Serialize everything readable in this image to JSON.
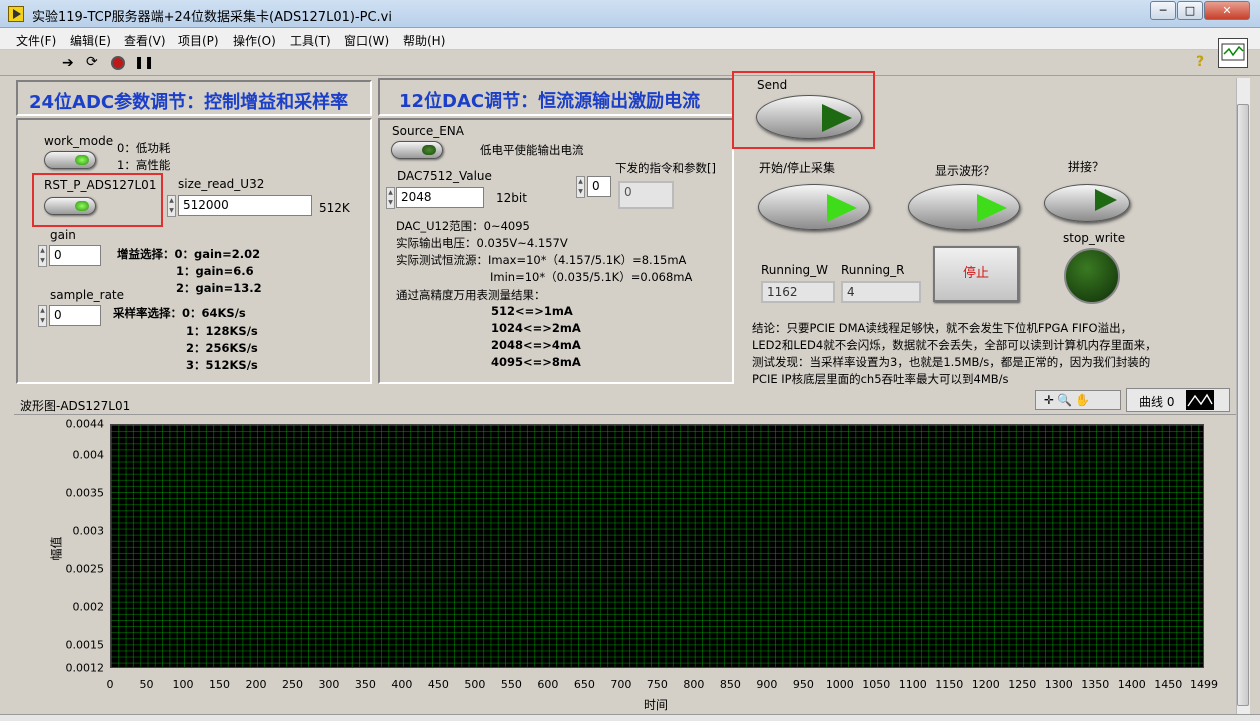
{
  "window": {
    "title": "实验119-TCP服务器端+24位数据采集卡(ADS127L01)-PC.vi",
    "min": "─",
    "max": "□",
    "close": "✕"
  },
  "menu": [
    "文件(F)",
    "编辑(E)",
    "查看(V)",
    "项目(P)",
    "操作(O)",
    "工具(T)",
    "窗口(W)",
    "帮助(H)"
  ],
  "adc": {
    "title": "24位ADC参数调节：控制增益和采样率",
    "work_mode_label": "work_mode",
    "mode0": "0：低功耗",
    "mode1": "1：高性能",
    "rst_label": "RST_P_ADS127L01",
    "size_label": "size_read_U32",
    "size_value": "512000",
    "size_unit": "512K",
    "gain_label": "gain",
    "gain_value": "0",
    "gain_sel": "增益选择：0：gain=2.02",
    "gain1": "1：gain=6.6",
    "gain2": "2：gain=13.2",
    "rate_label": "sample_rate",
    "rate_value": "0",
    "rate_sel": "采样率选择：0：64KS/s",
    "rate1": "1：128KS/s",
    "rate2": "2：256KS/s",
    "rate3": "3：512KS/s"
  },
  "dac": {
    "title": "12位DAC调节：恒流源输出激励电流",
    "source_label": "Source_ENA",
    "source_desc": "低电平使能输出电流",
    "dac_label": "DAC7512_Value",
    "dac_value": "2048",
    "dac_bits": "12bit",
    "cmd_label": "下发的指令和参数[]",
    "cmd_index": "0",
    "cmd_value": "0",
    "range": "DAC_U12范围：0~4095",
    "voltage": "实际输出电压：0.035V~4.157V",
    "current1": "实际测试恒流源：Imax=10*（4.157/5.1K）=8.15mA",
    "current2": "Imin=10*（0.035/5.1K）=0.068mA",
    "meas": "通过高精度万用表测量结果：",
    "m1": "512<=>1mA",
    "m2": "1024<=>2mA",
    "m3": "2048<=>4mA",
    "m4": "4095<=>8mA"
  },
  "ctrl": {
    "send_label": "Send",
    "start_label": "开始/停止采集",
    "show_label": "显示波形？",
    "splice_label": "拼接？",
    "stop_write_label": "stop_write",
    "rw_label": "Running_W",
    "rw_value": "1162",
    "rr_label": "Running_R",
    "rr_value": "4",
    "stop_btn": "停止",
    "note1": "结论：只要PCIE DMA读线程足够快，就不会发生下位机FPGA FIFO溢出，",
    "note2": "LED2和LED4就不会闪烁，数据就不会丢失，全部可以读到计算机内存里面来，",
    "note3": "测试发现：当采样率设置为3，也就是1.5MB/s，都是正常的，因为我们封装的",
    "note4": "PCIE IP核底层里面的ch5吞吐率最大可以到4MB/s"
  },
  "graph": {
    "title": "波形图-ADS127L01",
    "legend": "曲线 0",
    "ylabel": "幅值",
    "xlabel": "时间",
    "yticks": [
      "0.0044",
      "0.004",
      "0.0035",
      "0.003",
      "0.0025",
      "0.002",
      "0.0015",
      "0.0012"
    ],
    "xticks": [
      "0",
      "50",
      "100",
      "150",
      "200",
      "250",
      "300",
      "350",
      "400",
      "450",
      "500",
      "550",
      "600",
      "650",
      "700",
      "750",
      "800",
      "850",
      "900",
      "950",
      "1000",
      "1050",
      "1100",
      "1150",
      "1200",
      "1250",
      "1300",
      "1350",
      "1400",
      "1450",
      "1499"
    ]
  },
  "colors": {
    "title_blue": "#1c3fc8",
    "highlight": "#e03030",
    "led_on": "#3fdc1a",
    "plot_bg": "#000000",
    "grid": "#00a000"
  }
}
